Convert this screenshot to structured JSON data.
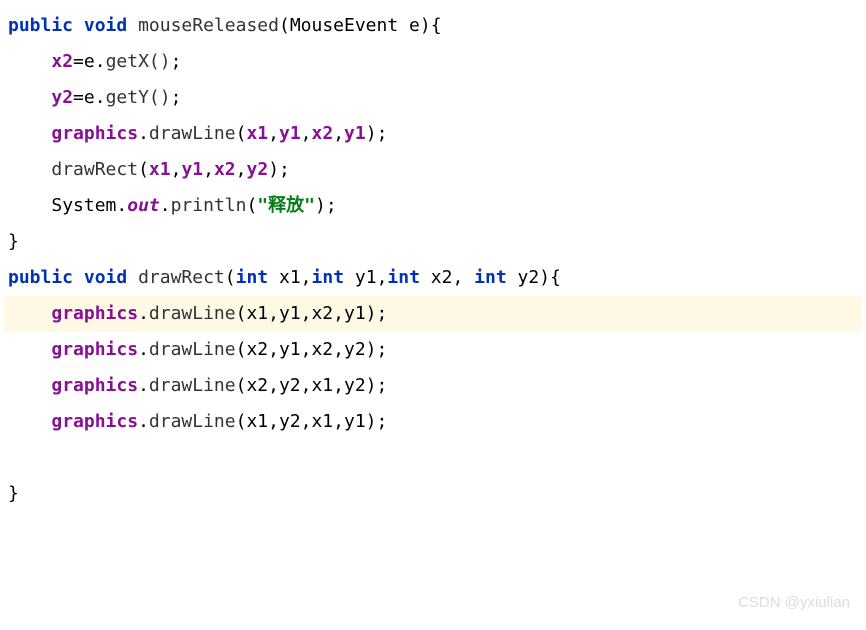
{
  "code": {
    "line1": {
      "kw_public": "public",
      "kw_void": "void",
      "method": "mouseReleased",
      "lparen": "(",
      "paramType": "MouseEvent",
      "paramName": "e",
      "rparen": ")",
      "brace": "{"
    },
    "line2": {
      "indent": "    ",
      "field": "x2",
      "eq": "=",
      "obj": "e",
      "dot": ".",
      "call": "getX()",
      "semi": ";"
    },
    "line3": {
      "indent": "    ",
      "field": "y2",
      "eq": "=",
      "obj": "e",
      "dot": ".",
      "call": "getY()",
      "semi": ";"
    },
    "line4": {
      "indent": "    ",
      "obj": "graphics",
      "dot": ".",
      "method": "drawLine",
      "lparen": "(",
      "a1": "x1",
      "c1": ",",
      "a2": "y1",
      "c2": ",",
      "a3": "x2",
      "c3": ",",
      "a4": "y1",
      "rparen": ")",
      "semi": ";"
    },
    "line5": {
      "indent": "    ",
      "method": "drawRect",
      "lparen": "(",
      "a1": "x1",
      "c1": ",",
      "a2": "y1",
      "c2": ",",
      "a3": "x2",
      "c3": ",",
      "a4": "y2",
      "rparen": ")",
      "semi": ";"
    },
    "line6": {
      "indent": "    ",
      "sys": "System",
      "dot1": ".",
      "out": "out",
      "dot2": ".",
      "method": "println",
      "lparen": "(",
      "str": "\"释放\"",
      "rparen": ")",
      "semi": ";"
    },
    "line7": {
      "brace": "}"
    },
    "line8": {
      "kw_public": "public",
      "kw_void": "void",
      "method": "drawRect",
      "lparen": "(",
      "kw_int1": "int",
      "p1": "x1",
      "c1": ",",
      "kw_int2": "int",
      "p2": "y1",
      "c2": ",",
      "kw_int3": "int",
      "p3": "x2",
      "c3": ", ",
      "kw_int4": "int",
      "p4": "y2",
      "rparen": ")",
      "brace": "{"
    },
    "line9": {
      "indent": "    ",
      "obj": "graphics",
      "dot": ".",
      "method": "drawLine",
      "args": "(x1,y1,x2,y1);"
    },
    "line10": {
      "indent": "    ",
      "obj": "graphics",
      "dot": ".",
      "method": "drawLine",
      "args": "(x2,y1,x2,y2);"
    },
    "line11": {
      "indent": "    ",
      "obj": "graphics",
      "dot": ".",
      "method": "drawLine",
      "args": "(x2,y2,x1,y2);"
    },
    "line12": {
      "indent": "    ",
      "obj": "graphics",
      "dot": ".",
      "method": "drawLine",
      "args": "(x1,y2,x1,y1);"
    },
    "blank": " ",
    "line13": {
      "brace": "}"
    }
  },
  "watermark": "CSDN @yxiulian"
}
